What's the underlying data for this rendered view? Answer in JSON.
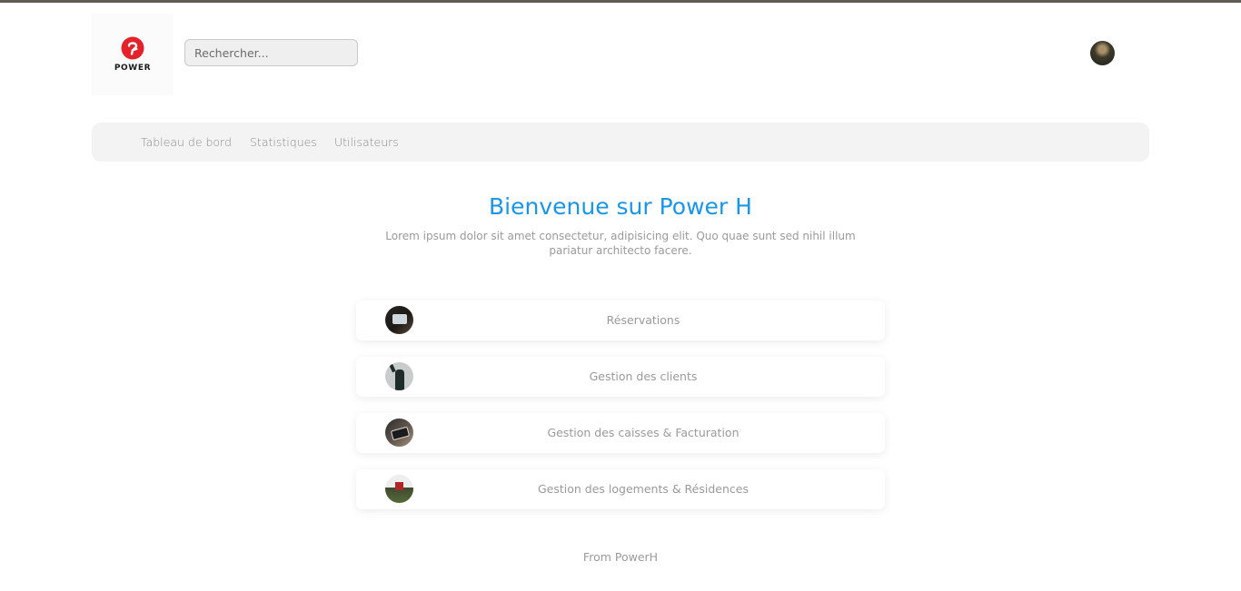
{
  "brand": {
    "logo_text": "POWER",
    "accent_color": "#e3222a",
    "logo_icon": "power-logo-icon"
  },
  "search": {
    "placeholder": "Rechercher..."
  },
  "user": {
    "avatar_icon": "user-avatar"
  },
  "nav": {
    "items": [
      {
        "label": "Tableau de bord"
      },
      {
        "label": "Statistiques"
      },
      {
        "label": "Utilisateurs"
      }
    ]
  },
  "hero": {
    "title": "Bienvenue sur Power H",
    "title_color": "#1a96e8",
    "text": "Lorem ipsum dolor sit amet consectetur, adipisicing elit. Quo quae sunt sed nihil illum pariatur architecto facere."
  },
  "modules": [
    {
      "label": "Réservations",
      "icon": "reservations-thumbnail"
    },
    {
      "label": "Gestion des clients",
      "icon": "clients-thumbnail"
    },
    {
      "label": "Gestion des caisses & Facturation",
      "icon": "billing-thumbnail"
    },
    {
      "label": "Gestion des logements & Résidences",
      "icon": "housing-thumbnail"
    }
  ],
  "footer": {
    "text": "From PowerH"
  }
}
